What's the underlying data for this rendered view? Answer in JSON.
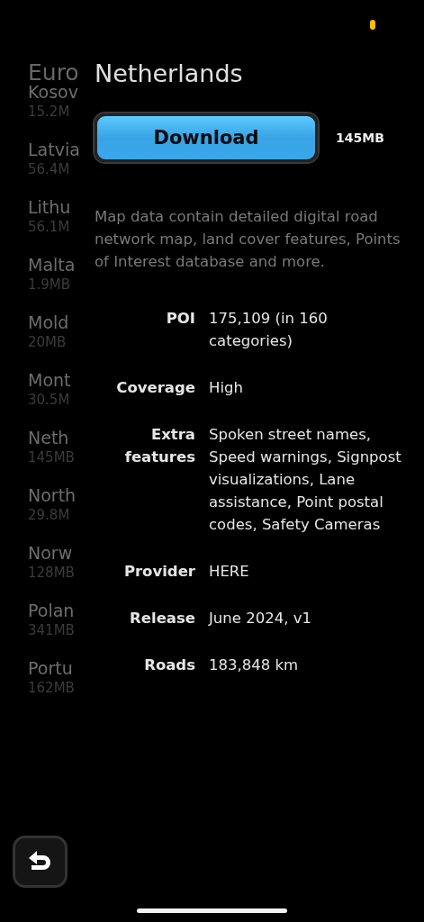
{
  "list": {
    "header": "Euro",
    "items": [
      {
        "name": "Kosov",
        "size": "15.2M"
      },
      {
        "name": "Latvia",
        "size": "56.4M"
      },
      {
        "name": "Lithu",
        "size": "56.1M"
      },
      {
        "name": "Malta",
        "size": "1.9MB"
      },
      {
        "name": "Mold",
        "size": "20MB"
      },
      {
        "name": "Mont",
        "size": "30.5M"
      },
      {
        "name": "Neth",
        "size": "145MB"
      },
      {
        "name": "North",
        "size": "29.8M"
      },
      {
        "name": "Norw",
        "size": "128MB"
      },
      {
        "name": "Polan",
        "size": "341MB"
      },
      {
        "name": "Portu",
        "size": "162MB"
      }
    ]
  },
  "detail": {
    "title": "Netherlands",
    "button": "Download",
    "size": "145MB",
    "description": "Map data contain detailed digital road network map, land cover features, Points of Interest database and more.",
    "fields": [
      {
        "label": "POI",
        "value": "175,109 (in 160 categories)"
      },
      {
        "label": "Coverage",
        "value": "High"
      },
      {
        "label": "Extra features",
        "value": "Spoken street names, Speed warnings, Signpost visualizations, Lane assistance, Point postal codes, Safety Cameras"
      },
      {
        "label": "Provider",
        "value": "HERE"
      },
      {
        "label": "Release",
        "value": "June 2024, v1"
      },
      {
        "label": "Roads",
        "value": "183,848 km"
      }
    ]
  }
}
